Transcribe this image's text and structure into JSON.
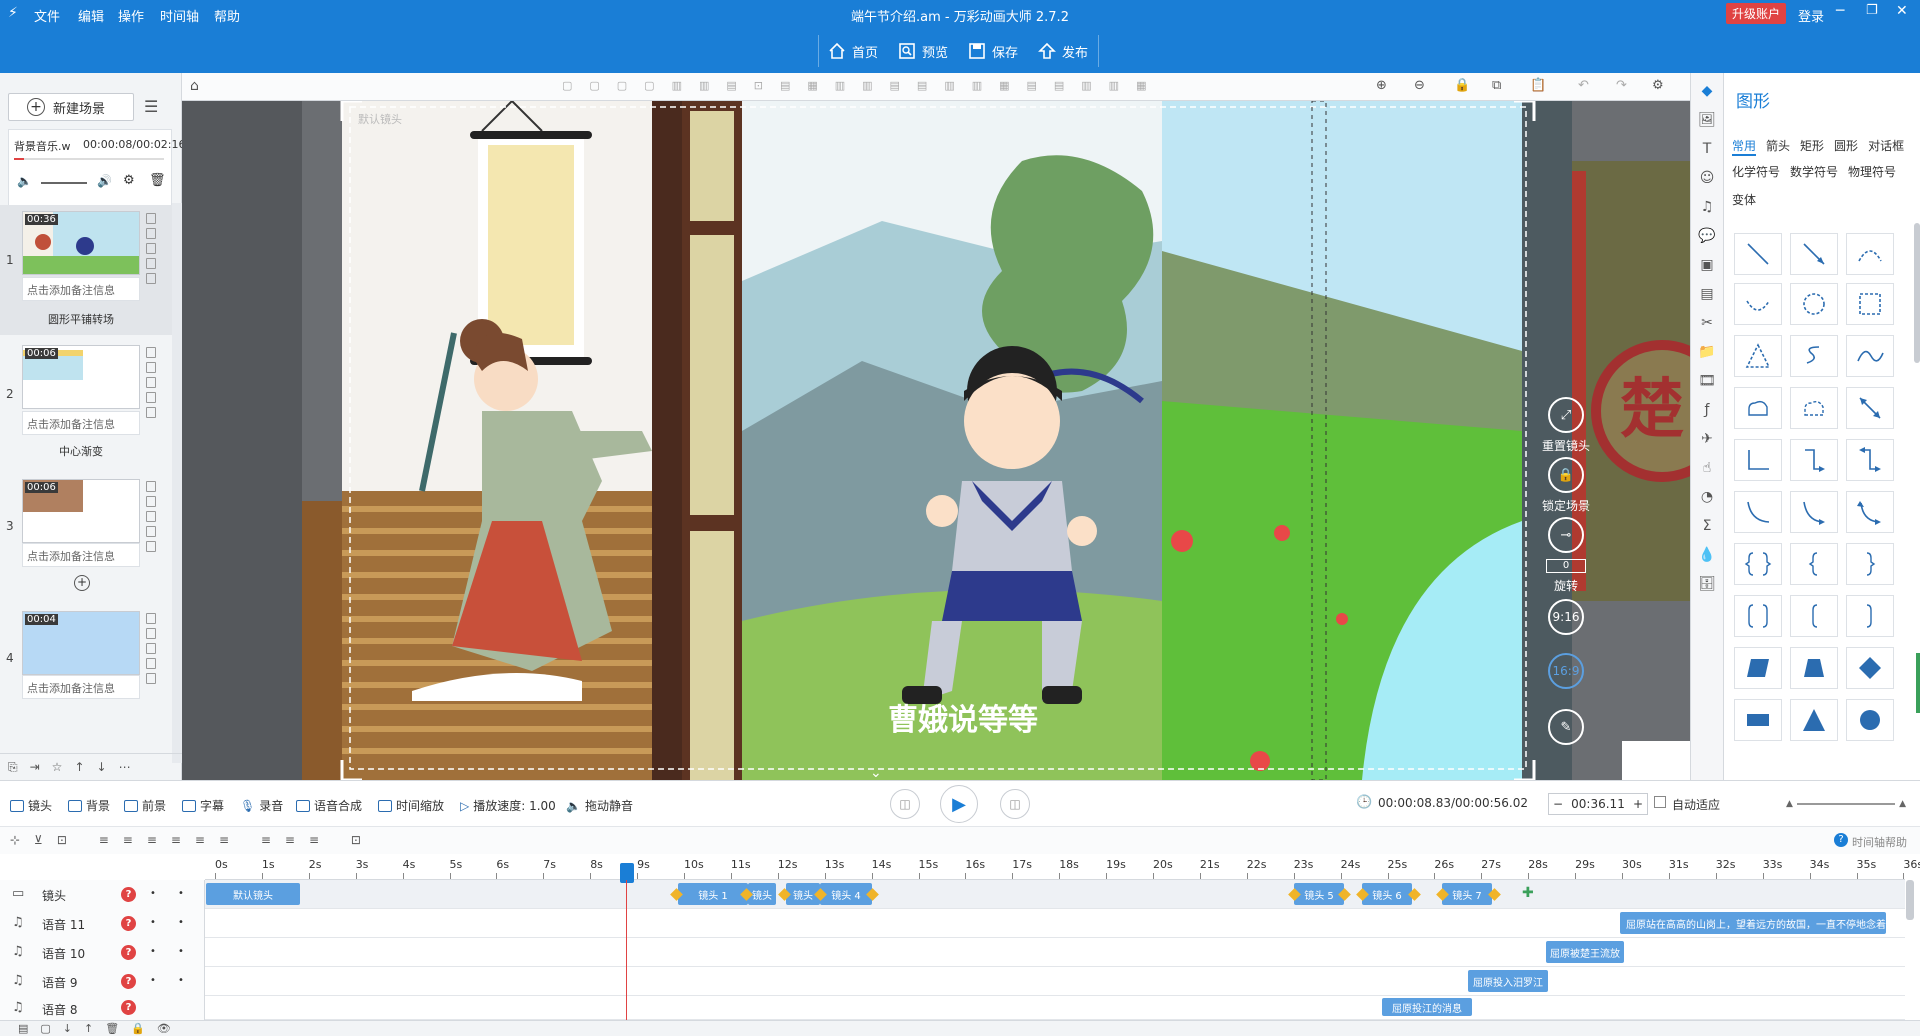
{
  "app": {
    "title": "端午节介绍.am - 万彩动画大师 2.7.2",
    "menus": [
      "文件",
      "编辑",
      "操作",
      "时间轴",
      "帮助"
    ],
    "upgrade": "升级账户",
    "login": "登录",
    "colors": {
      "brand": "#1a7ed6",
      "accent": "#e04343",
      "clip": "#5b9fe0",
      "keyframe": "#f0b429"
    }
  },
  "toolbar": {
    "home": "首页",
    "preview": "预览",
    "save": "保存",
    "publish": "发布"
  },
  "left": {
    "new_scene": "新建场景",
    "bgm_label": "背景音乐.w",
    "bgm_time": "00:00:08/00:02:16",
    "scenes": [
      {
        "num": "1",
        "time": "00:36",
        "note": "点击添加备注信息",
        "transition": "圆形平铺转场"
      },
      {
        "num": "2",
        "time": "00:06",
        "note": "点击添加备注信息",
        "transition": "中心渐变"
      },
      {
        "num": "3",
        "time": "00:06",
        "note": "点击添加备注信息",
        "transition": ""
      },
      {
        "num": "4",
        "time": "00:04",
        "note": "点击添加备注信息",
        "transition": ""
      }
    ]
  },
  "canvas": {
    "camera_label": "默认镜头",
    "subtitle": "曹娥说等等",
    "reset_camera": "重置镜头",
    "lock_scene": "锁定场景",
    "rotate": "旋转",
    "rotate_value": "0",
    "ratio_916": "9:16",
    "ratio_169": "16:9",
    "seal_char": "楚"
  },
  "shapes": {
    "title": "图形",
    "tabs_row1": [
      "常用",
      "箭头",
      "矩形",
      "圆形",
      "对话框"
    ],
    "tabs_row2": [
      "化学符号",
      "数学符号",
      "物理符号"
    ],
    "tabs_row3": [
      "变体"
    ]
  },
  "tracks_bar": {
    "items": [
      "镜头",
      "背景",
      "前景",
      "字幕",
      "录音",
      "语音合成",
      "时间缩放",
      "播放速度: 1.00",
      "拖动静音"
    ],
    "time_display": "00:00:08.83/00:00:56.02",
    "duration": "00:36.11",
    "auto_fit": "自动适应",
    "help": "时间轴帮助"
  },
  "ruler": {
    "labels": [
      "0s",
      "1s",
      "2s",
      "3s",
      "4s",
      "5s",
      "6s",
      "7s",
      "8s",
      "9s",
      "10s",
      "11s",
      "12s",
      "13s",
      "14s",
      "15s",
      "16s",
      "17s",
      "18s",
      "19s",
      "20s",
      "21s",
      "22s",
      "23s",
      "24s",
      "25s",
      "26s",
      "27s",
      "28s",
      "29s",
      "30s",
      "31s",
      "32s",
      "33s",
      "34s",
      "35s",
      "36s"
    ]
  },
  "tracks": {
    "rows": [
      {
        "name": "镜头"
      },
      {
        "name": "语音 11"
      },
      {
        "name": "语音 10"
      },
      {
        "name": "语音 9"
      },
      {
        "name": "语音 8"
      }
    ],
    "camera_clips": {
      "default": "默认镜头",
      "c1": "镜头 1",
      "c2": "镜头",
      "c3": "镜头",
      "c4": "镜头 4",
      "c5": "镜头 5",
      "c6": "镜头 6",
      "c7": "镜头 7"
    },
    "voice_clips": {
      "v11": "屈原站在高高的山岗上，望着远方的故国，一直不停地念着",
      "v10": "屈原被楚王流放",
      "v9": "屈原投入汨罗江",
      "v8": "屈原投江的消息"
    }
  }
}
